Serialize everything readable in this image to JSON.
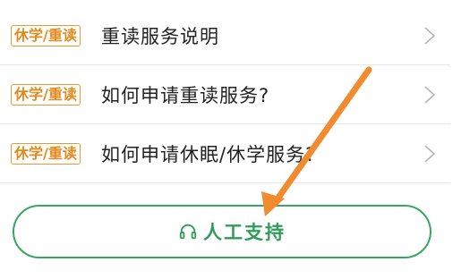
{
  "faq": {
    "items": [
      {
        "tag": "休学/重读",
        "title": "重读服务说明"
      },
      {
        "tag": "休学/重读",
        "title": "如何申请重读服务?"
      },
      {
        "tag": "休学/重读",
        "title": "如何申请休眠/休学服务?"
      }
    ]
  },
  "support": {
    "label": "人工支持",
    "icon": "headset-icon"
  },
  "colors": {
    "tag": "#e08a1f",
    "support_green": "#2e9d56",
    "annotation_arrow": "#f28a2e"
  }
}
